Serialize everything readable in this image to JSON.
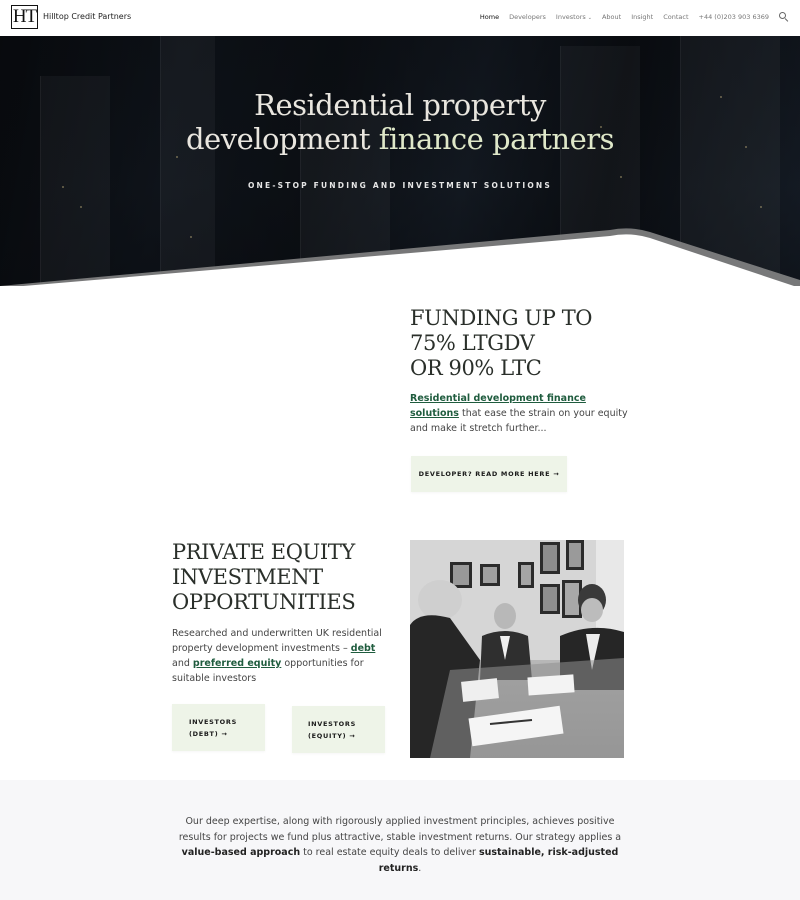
{
  "brand": {
    "logo_text": "HT",
    "name": "Hilltop Credit Partners"
  },
  "nav": {
    "items": [
      {
        "label": "Home",
        "active": true
      },
      {
        "label": "Developers"
      },
      {
        "label": "Investors",
        "dropdown": true
      },
      {
        "label": "About"
      },
      {
        "label": "Insight"
      },
      {
        "label": "Contact"
      }
    ],
    "phone": "+44 (0)203 903 6369",
    "search_icon": "search-icon"
  },
  "hero": {
    "title_line1": "Residential property",
    "title_line2_a": "development ",
    "title_line2_b": "finance partners",
    "subtitle": "ONE-STOP FUNDING AND INVESTMENT SOLUTIONS"
  },
  "funding": {
    "title_line1": "FUNDING UP TO",
    "title_line2": "75% LTGDV",
    "title_line3": "OR 90% LTC",
    "link_text": "Residential development finance solutions",
    "body_text": "that ease the strain on your equity and make it stretch further...",
    "button_label": "DEVELOPER? READ MORE HERE →"
  },
  "private_equity": {
    "title_line1": "PRIVATE EQUITY",
    "title_line2": "INVESTMENT",
    "title_line3": "OPPORTUNITIES",
    "text_before": "Researched and underwritten UK residential property development investments – ",
    "link_debt": "debt",
    "text_and": " and ",
    "link_equity": "preferred equity",
    "text_after": " opportunities for suitable investors",
    "btn_debt_line1": "INVESTORS",
    "btn_debt_line2": "(DEBT) →",
    "btn_equity_line1": "INVESTORS",
    "btn_equity_line2": "(EQUITY) →"
  },
  "bottom": {
    "text_1": "Our deep expertise, along with rigorously applied investment principles, achieves positive results for projects we fund plus attractive, stable investment returns. Our strategy applies a ",
    "bold_1": "value-based approach",
    "text_2": " to real estate equity deals to deliver ",
    "bold_2": "sustainable, risk-adjusted returns",
    "text_3": "."
  }
}
